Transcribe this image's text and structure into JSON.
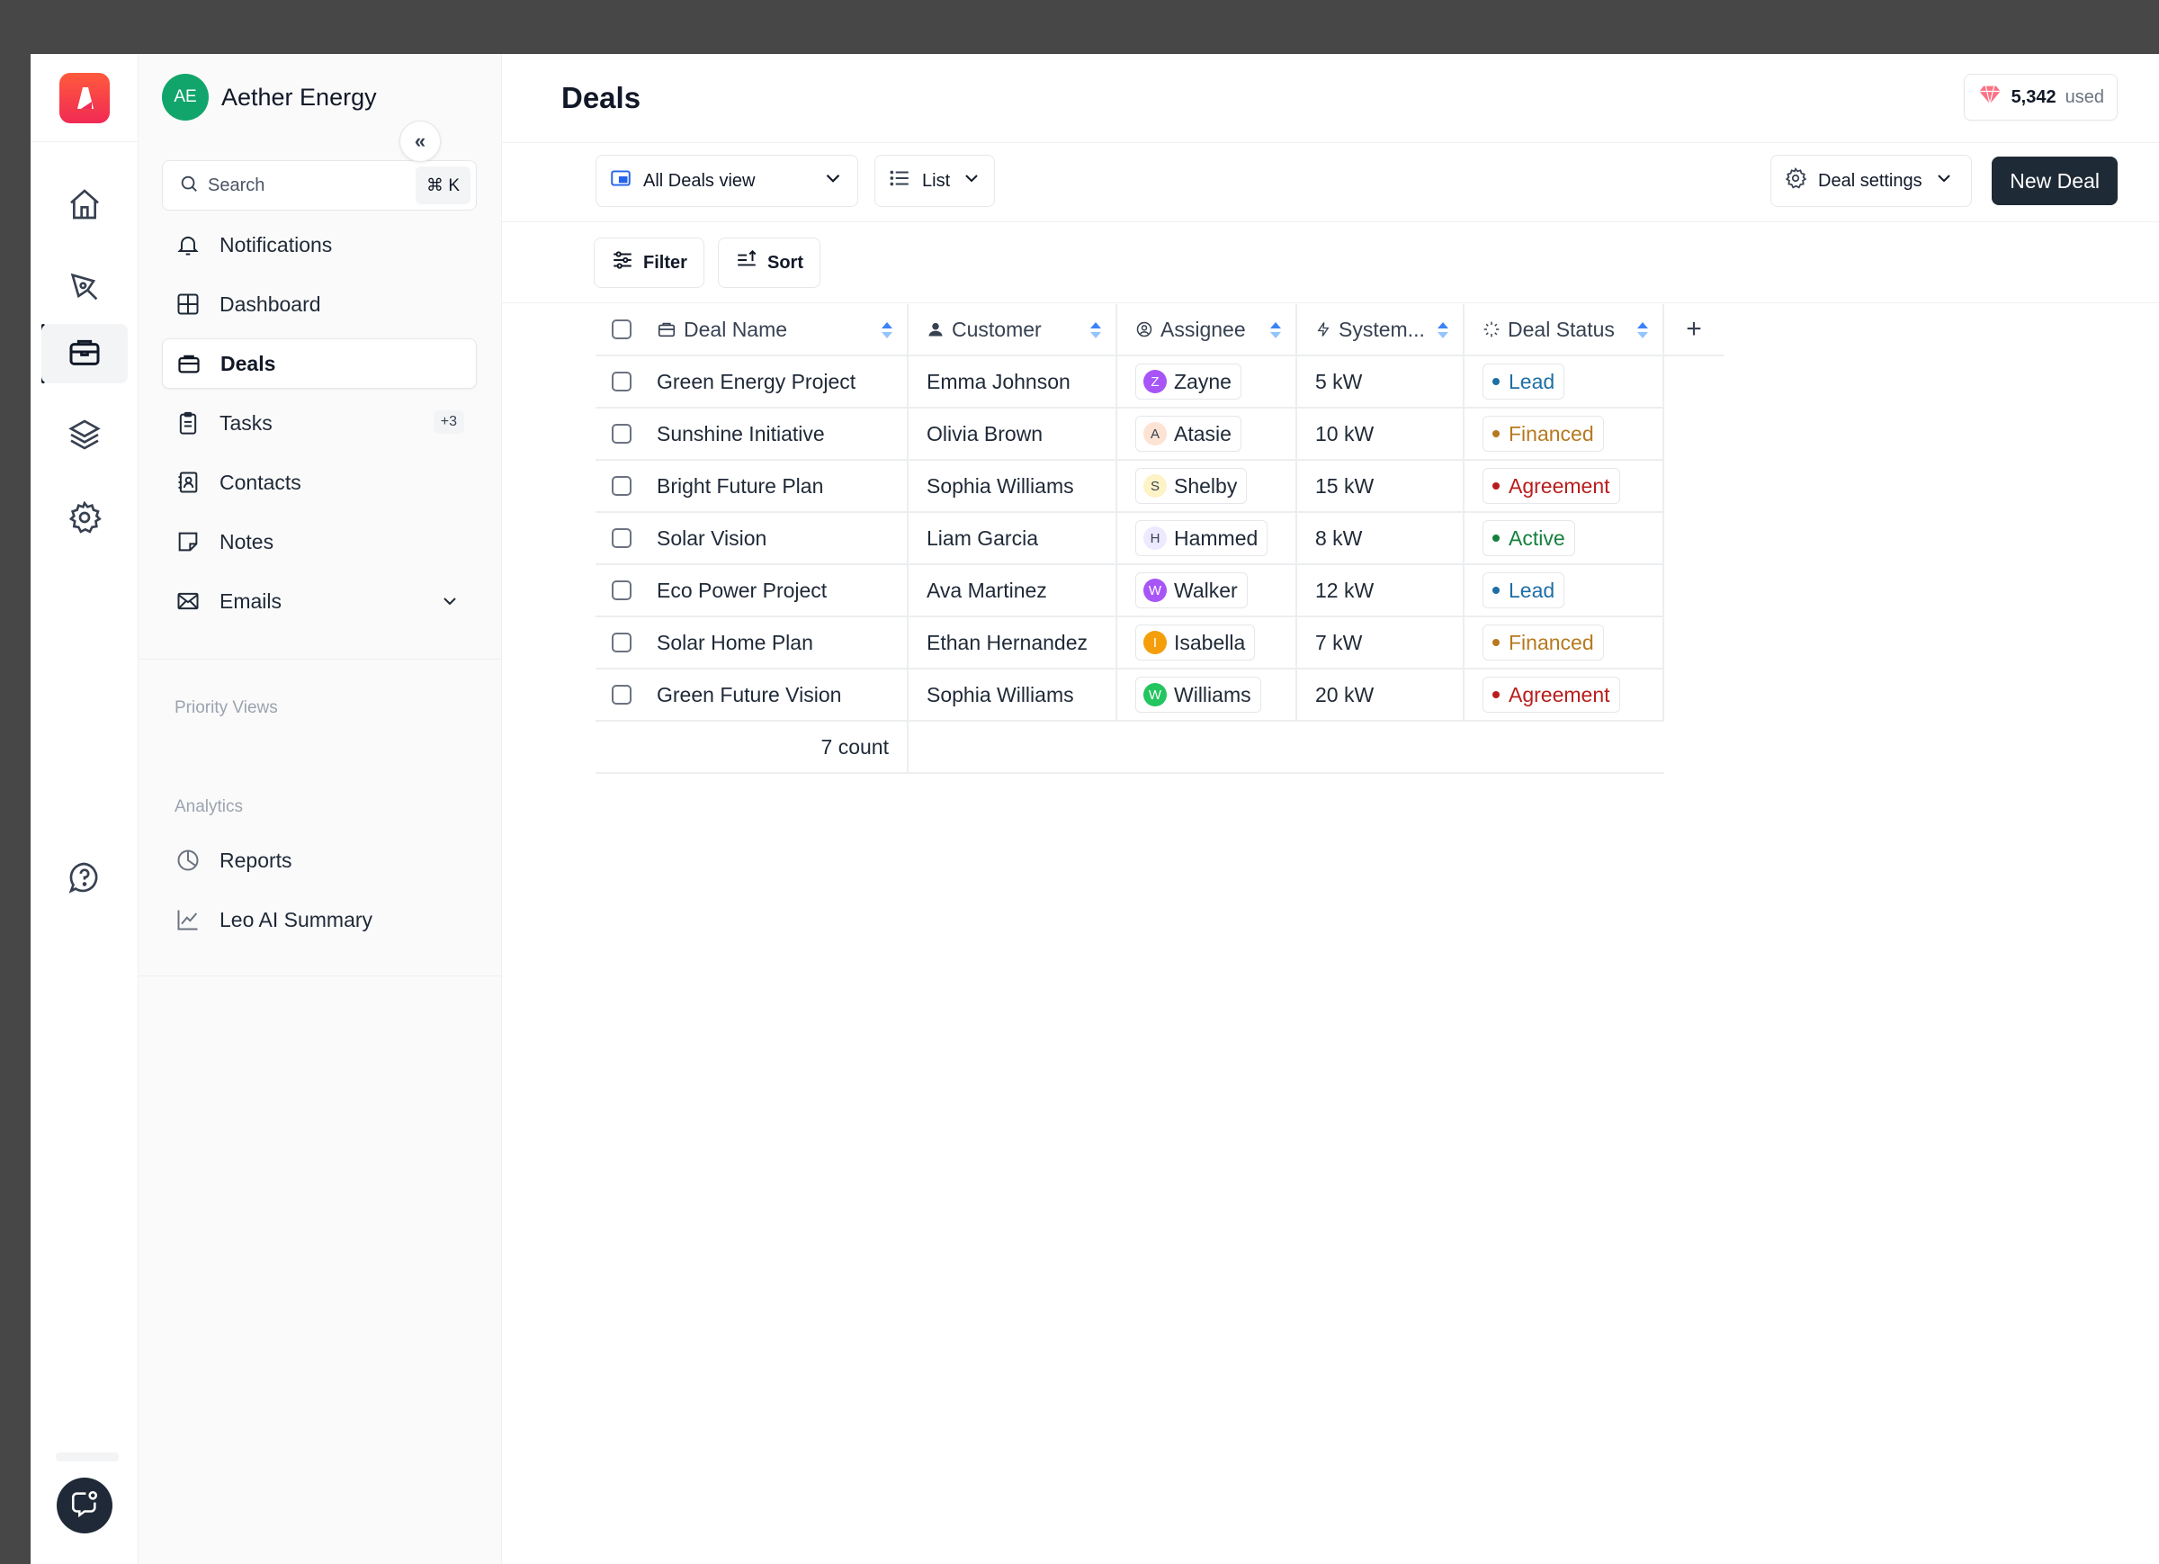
{
  "workspace": {
    "initials": "AE",
    "name": "Aether Energy"
  },
  "search": {
    "placeholder": "Search",
    "shortcut": "⌘ K"
  },
  "sidebar": {
    "items": [
      {
        "label": "Notifications",
        "icon": "bell-icon"
      },
      {
        "label": "Dashboard",
        "icon": "grid-icon"
      },
      {
        "label": "Deals",
        "icon": "briefcase-icon",
        "active": true
      },
      {
        "label": "Tasks",
        "icon": "clipboard-icon",
        "badge": "+3"
      },
      {
        "label": "Contacts",
        "icon": "address-book-icon"
      },
      {
        "label": "Notes",
        "icon": "note-icon"
      },
      {
        "label": "Emails",
        "icon": "mail-icon"
      }
    ],
    "priority_views_title": "Priority Views",
    "analytics_title": "Analytics",
    "analytics_items": [
      {
        "label": "Reports",
        "icon": "pie-chart-icon"
      },
      {
        "label": "Leo AI Summary",
        "icon": "line-chart-icon"
      }
    ]
  },
  "header": {
    "title": "Deals",
    "credits_value": "5,342",
    "credits_suffix": "used"
  },
  "toolbar": {
    "view_label": "All Deals view",
    "layout_label": "List",
    "settings_label": "Deal settings",
    "new_deal_label": "New Deal",
    "filter_label": "Filter",
    "sort_label": "Sort"
  },
  "table": {
    "columns": [
      "Deal Name",
      "Customer",
      "Assignee",
      "System...",
      "Deal Status"
    ],
    "add_column": "+",
    "rows": [
      {
        "deal": "Green Energy Project",
        "customer": "Emma Johnson",
        "assignee": "Zayne",
        "initial": "Z",
        "system": "5 kW",
        "status": "Lead"
      },
      {
        "deal": "Sunshine Initiative",
        "customer": "Olivia Brown",
        "assignee": "Atasie",
        "initial": "A",
        "system": "10 kW",
        "status": "Financed"
      },
      {
        "deal": "Bright Future Plan",
        "customer": "Sophia Williams",
        "assignee": "Shelby",
        "initial": "S",
        "system": "15 kW",
        "status": "Agreement"
      },
      {
        "deal": "Solar Vision",
        "customer": "Liam Garcia",
        "assignee": "Hammed",
        "initial": "H",
        "system": "8 kW",
        "status": "Active"
      },
      {
        "deal": "Eco Power Project",
        "customer": "Ava Martinez",
        "assignee": "Walker",
        "initial": "W",
        "system": "12 kW",
        "status": "Lead"
      },
      {
        "deal": "Solar Home Plan",
        "customer": "Ethan Hernandez",
        "assignee": "Isabella",
        "initial": "I",
        "system": "7 kW",
        "status": "Financed"
      },
      {
        "deal": "Green Future Vision",
        "customer": "Sophia Williams",
        "assignee": "Williams",
        "initial": "W",
        "system": "20 kW",
        "status": "Agreement"
      }
    ],
    "footer_count": "7 count"
  },
  "colors": {
    "lead": "#1d6fa5",
    "financed": "#b7791f",
    "agreement": "#b91c1c",
    "active": "#15803d",
    "primary_button": "#1f2a37",
    "workspace_avatar": "#12a56b",
    "logo": "#f43f5e"
  }
}
